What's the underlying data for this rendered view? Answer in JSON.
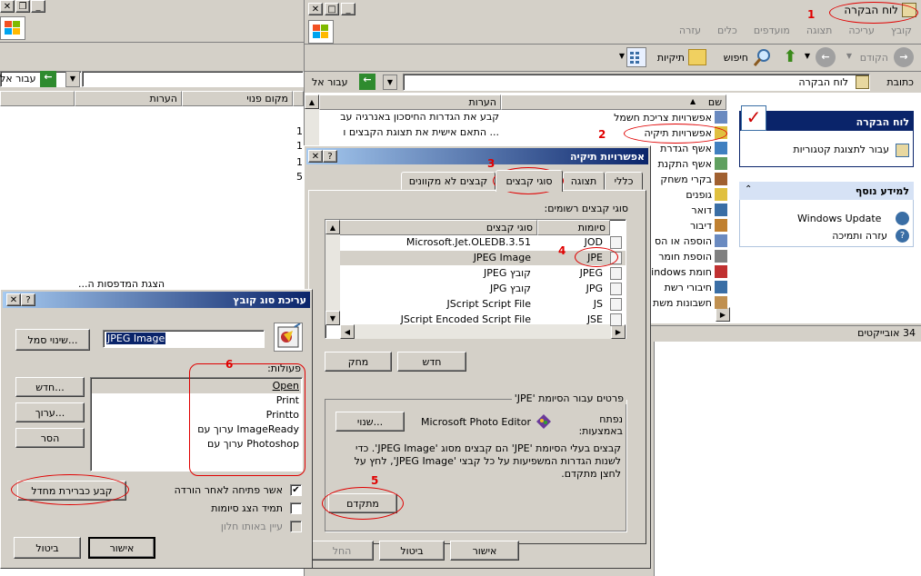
{
  "left_window": {
    "go_label": "עבור אל",
    "columns": [
      "מקום פנוי",
      "הערות"
    ],
    "printers_text": "הצגת המדפסות ה..."
  },
  "main_window": {
    "menu": [
      "קובץ",
      "עריכה",
      "תצוגה",
      "מועדפים",
      "כלים",
      "עזרה"
    ],
    "toolbar": {
      "back": "הקודם",
      "search": "חיפוש",
      "folders": "תיקיות"
    },
    "address_label": "כתובת",
    "address_value": "לוח הבקרה",
    "go_label": "עבור אל",
    "window_title": "לוח הבקרה",
    "side_panel": {
      "panel_title": "לוח הבקרה",
      "switch_view": "עבור לתצוגת קטגוריות",
      "see_also_title": "למידע נוסף",
      "links": [
        "Windows Update",
        "עזרה ותמיכה"
      ]
    },
    "columns": {
      "name": "שם",
      "comments": "הערות"
    },
    "items": [
      {
        "name": "אפשרויות צריכת חשמל",
        "comment": "קבע את הגדרות החיסכון באנרגיה עב"
      },
      {
        "name": "אפשרויות תיקיה",
        "comment": "... התאם אישית את תצוגת הקבצים ו"
      },
      {
        "name": "אשף הגדרת"
      },
      {
        "name": "אשף התקנת"
      },
      {
        "name": "בקרי משחק"
      },
      {
        "name": "גופנים"
      },
      {
        "name": "דואר"
      },
      {
        "name": "דיבור"
      },
      {
        "name": "הוספה או הס"
      },
      {
        "name": "הוספת חומר"
      },
      {
        "name": "חומת Windows"
      },
      {
        "name": "חיבורי רשת"
      },
      {
        "name": "חשבונות משת"
      }
    ],
    "status": "34 אובייקטים"
  },
  "folder_options": {
    "title": "אפשרויות תיקיה",
    "tabs": [
      "כללי",
      "תצוגה",
      "סוגי קבצים",
      "קבצים לא מקוונים"
    ],
    "registered_label": "סוגי קבצים רשומים:",
    "col_ext": "סיומות",
    "col_type": "סוגי קבצים",
    "rows": [
      {
        "ext": "JOD",
        "type": "Microsoft.Jet.OLEDB.3.51"
      },
      {
        "ext": "JPE",
        "type": "JPEG Image"
      },
      {
        "ext": "JPEG",
        "type": "JPEG קובץ"
      },
      {
        "ext": "JPG",
        "type": "JPG קובץ"
      },
      {
        "ext": "JS",
        "type": "JScript Script File"
      },
      {
        "ext": "JSE",
        "type": "JScript Encoded Script File"
      }
    ],
    "new_btn": "חדש",
    "delete_btn": "מחק",
    "details_group": "פרטים עבור הסיומת 'JPE'",
    "opens_with_label": "נפתח באמצעות:",
    "opens_with_value": "Microsoft Photo Editor",
    "change_btn": "שנוי...",
    "description": "קבצים בעלי הסיומת 'JPE' הם קבצים מסוג 'JPEG Image'. כדי לשנות הגדרות המשפיעות על כל קבצי 'JPEG Image', לחץ על לחצן מתקדם.",
    "advanced_btn": "מתקדם",
    "ok_btn": "אישור",
    "cancel_btn": "ביטול",
    "apply_btn": "החל"
  },
  "edit_file_type": {
    "title": "עריכת סוג קובץ",
    "name_value": "JPEG Image",
    "change_icon_btn": "שינוי סמל...",
    "actions_label": "פעולות:",
    "actions": [
      "Open",
      "Print",
      "Printto",
      "ערוך עם ImageReady",
      "ערוך עם Photoshop"
    ],
    "new_btn": "חדש...",
    "edit_btn": "ערוך...",
    "remove_btn": "הסר",
    "set_default_btn": "קבע כברירת מחדל",
    "confirm_open_label": "אשר פתיחה לאחר הורדה",
    "always_show_ext_label": "תמיד הצג סיומות",
    "browse_same_window_label": "עיין באותו חלון",
    "ok_btn": "אישור",
    "cancel_btn": "ביטול"
  },
  "annotations": [
    "1",
    "2",
    "3",
    "4",
    "5",
    "6"
  ],
  "colors": {
    "annotation": "#e00000",
    "title_active": "#0a246a",
    "highlight": "#0a246a"
  }
}
